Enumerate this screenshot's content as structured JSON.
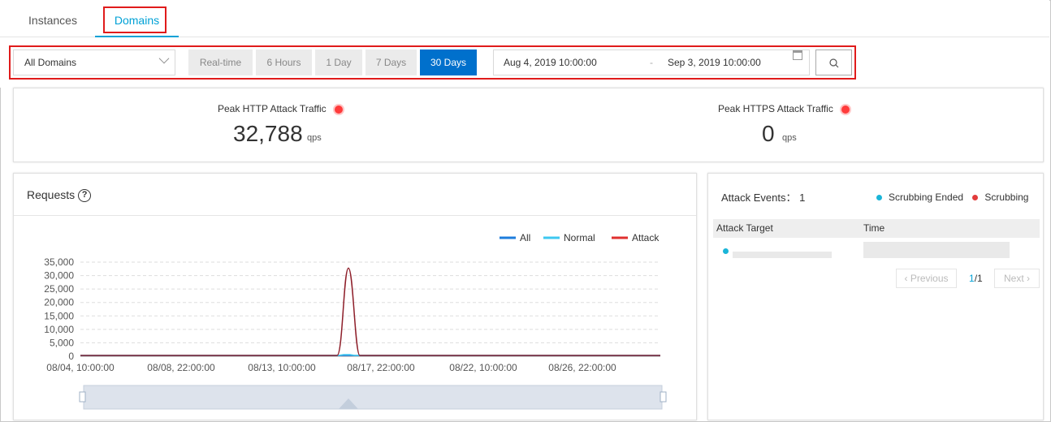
{
  "tabs": [
    {
      "label": "Instances"
    },
    {
      "label": "Domains"
    }
  ],
  "filters": {
    "domain_select": "All Domains",
    "ranges": [
      "Real-time",
      "6 Hours",
      "1 Day",
      "7 Days",
      "30 Days"
    ],
    "active_range": "30 Days",
    "start": "Aug 4, 2019 10:00:00",
    "separator": "-",
    "end": "Sep 3, 2019 10:00:00"
  },
  "peak": {
    "http": {
      "title": "Peak HTTP Attack Traffic",
      "value": "32,788",
      "unit": "qps"
    },
    "https": {
      "title": "Peak HTTPS Attack Traffic",
      "value": "0",
      "unit": "qps"
    }
  },
  "requests": {
    "title": "Requests",
    "help": "?"
  },
  "chart_data": {
    "type": "line",
    "yticks": [
      "35,000",
      "30,000",
      "25,000",
      "20,000",
      "15,000",
      "10,000",
      "5,000",
      "0"
    ],
    "ylim": [
      0,
      35000
    ],
    "xticks": [
      "08/04, 10:00:00",
      "08/08, 22:00:00",
      "08/13, 10:00:00",
      "08/17, 22:00:00",
      "08/22, 10:00:00",
      "08/26, 22:00:00"
    ],
    "series": [
      {
        "name": "All",
        "color": "#1e7ddc"
      },
      {
        "name": "Normal",
        "color": "#3ec8f0"
      },
      {
        "name": "Attack",
        "color": "#e0302f"
      }
    ],
    "attack_peak": {
      "value": 32788
    },
    "legend": "top-right",
    "grid": true
  },
  "events": {
    "title": "Attack Events：",
    "count": "1",
    "legend": [
      {
        "label": "Scrubbing Ended",
        "color": "#1ab5d8"
      },
      {
        "label": "Scrubbing",
        "color": "#e23b3b"
      }
    ],
    "columns": [
      "Attack Target",
      "Time"
    ],
    "pagination": {
      "prev": "Previous",
      "page": "1",
      "total": "/1",
      "next": "Next"
    }
  },
  "colors": {
    "accent": "#00a1d6",
    "primary": "#0070cc",
    "highlight": "#e01b1b"
  }
}
